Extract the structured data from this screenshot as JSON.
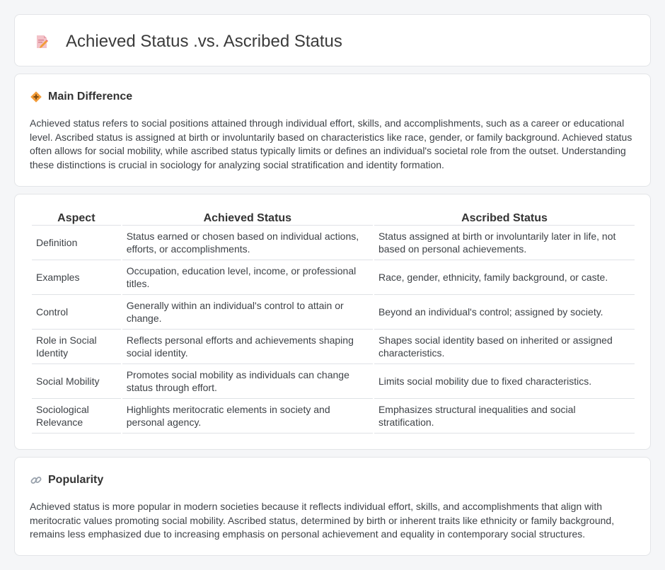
{
  "header": {
    "title": "Achieved Status .vs. Ascribed Status",
    "icon": "edit-document-icon"
  },
  "main_difference": {
    "heading": "Main Difference",
    "icon": "diamond-sign-icon",
    "text": "Achieved status refers to social positions attained through individual effort, skills, and accomplishments, such as a career or educational level. Ascribed status is assigned at birth or involuntarily based on characteristics like race, gender, or family background. Achieved status often allows for social mobility, while ascribed status typically limits or defines an individual's societal role from the outset. Understanding these distinctions is crucial in sociology for analyzing social stratification and identity formation."
  },
  "comparison_table": {
    "headers": [
      "Aspect",
      "Achieved Status",
      "Ascribed Status"
    ],
    "rows": [
      [
        "Definition",
        "Status earned or chosen based on individual actions, efforts, or accomplishments.",
        "Status assigned at birth or involuntarily later in life, not based on personal achievements."
      ],
      [
        "Examples",
        "Occupation, education level, income, or professional titles.",
        "Race, gender, ethnicity, family background, or caste."
      ],
      [
        "Control",
        "Generally within an individual's control to attain or change.",
        "Beyond an individual's control; assigned by society."
      ],
      [
        "Role in Social Identity",
        "Reflects personal efforts and achievements shaping social identity.",
        "Shapes social identity based on inherited or assigned characteristics."
      ],
      [
        "Social Mobility",
        "Promotes social mobility as individuals can change status through effort.",
        "Limits social mobility due to fixed characteristics."
      ],
      [
        "Sociological Relevance",
        "Highlights meritocratic elements in society and personal agency.",
        "Emphasizes structural inequalities and social stratification."
      ]
    ]
  },
  "popularity": {
    "heading": "Popularity",
    "icon": "link-icon",
    "text": "Achieved status is more popular in modern societies because it reflects individual effort, skills, and accomplishments that align with meritocratic values promoting social mobility. Ascribed status, determined by birth or inherent traits like ethnicity or family background, remains less emphasized due to increasing emphasis on personal achievement and equality in contemporary social structures."
  },
  "colors": {
    "background": "#f5f6f8",
    "card": "#ffffff",
    "accent_orange": "#f29b38",
    "icon_pink": "#e8667a"
  }
}
